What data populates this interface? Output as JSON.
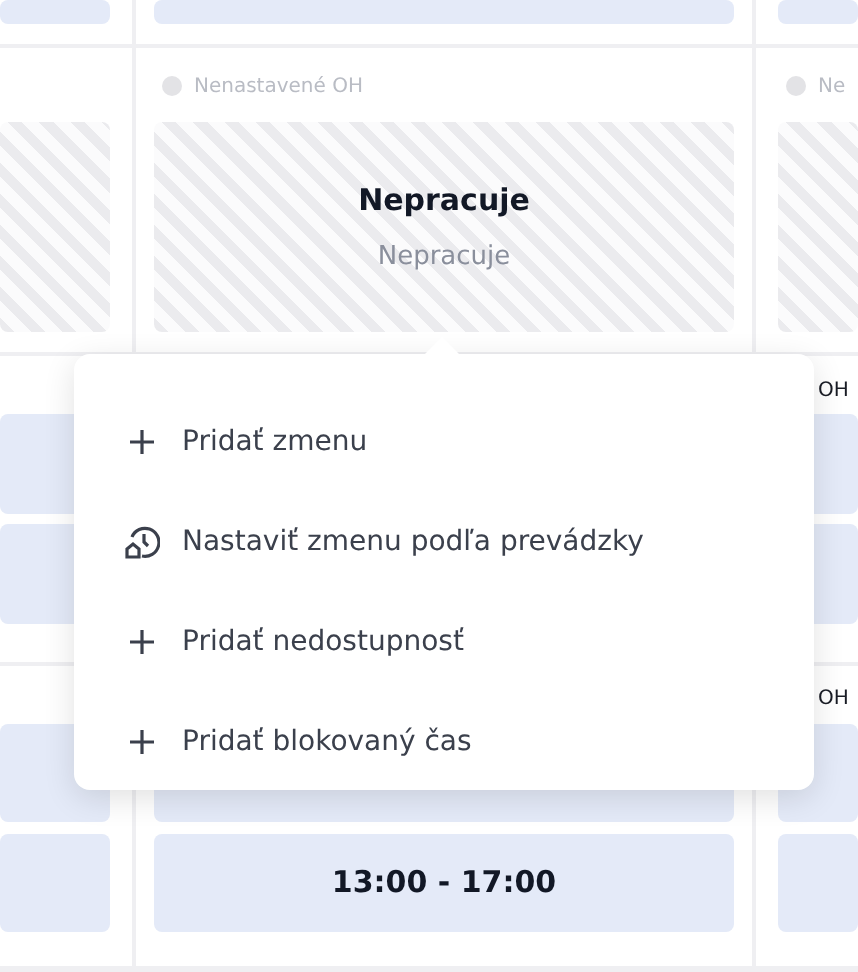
{
  "schedule": {
    "rows": [
      {
        "cells": [
          {
            "cards": [
              {
                "kind": "shift"
              }
            ]
          },
          {
            "cards": [
              {
                "kind": "shift"
              }
            ]
          },
          {
            "cards": [
              {
                "kind": "shift"
              }
            ]
          }
        ]
      },
      {
        "cells": [
          {
            "cards": [
              {
                "kind": "off"
              }
            ]
          },
          {
            "status": {
              "text": "Nenastavené OH",
              "set": false
            },
            "cards": [
              {
                "kind": "off",
                "title": "Nepracuje",
                "subtitle": "Nepracuje"
              }
            ]
          },
          {
            "status": {
              "text": "Ne",
              "set": false
            },
            "cards": [
              {
                "kind": "off"
              }
            ]
          }
        ]
      },
      {
        "cells": [
          {
            "cards": [
              {
                "kind": "shift"
              },
              {
                "kind": "shift"
              }
            ]
          },
          {},
          {
            "status": {
              "text": "OH",
              "set": true
            },
            "cards": [
              {
                "kind": "shift"
              },
              {
                "kind": "shift"
              }
            ]
          }
        ]
      },
      {
        "cells": [
          {
            "cards": [
              {
                "kind": "shift"
              },
              {
                "kind": "shift"
              }
            ]
          },
          {
            "cards": [
              {
                "kind": "shift"
              },
              {
                "kind": "shift",
                "title": "13:00 - 17:00"
              }
            ]
          },
          {
            "status": {
              "text": "OH",
              "set": true
            },
            "cards": [
              {
                "kind": "shift"
              },
              {
                "kind": "shift"
              }
            ]
          }
        ]
      }
    ]
  },
  "menu": {
    "items": [
      {
        "kind": "add",
        "label": "Pridať zmenu"
      },
      {
        "kind": "by_operation",
        "label": "Nastaviť zmenu podľa prevádzky"
      },
      {
        "kind": "add",
        "label": "Pridať nedostupnosť"
      },
      {
        "kind": "add",
        "label": "Pridať blokovaný čas"
      }
    ]
  }
}
